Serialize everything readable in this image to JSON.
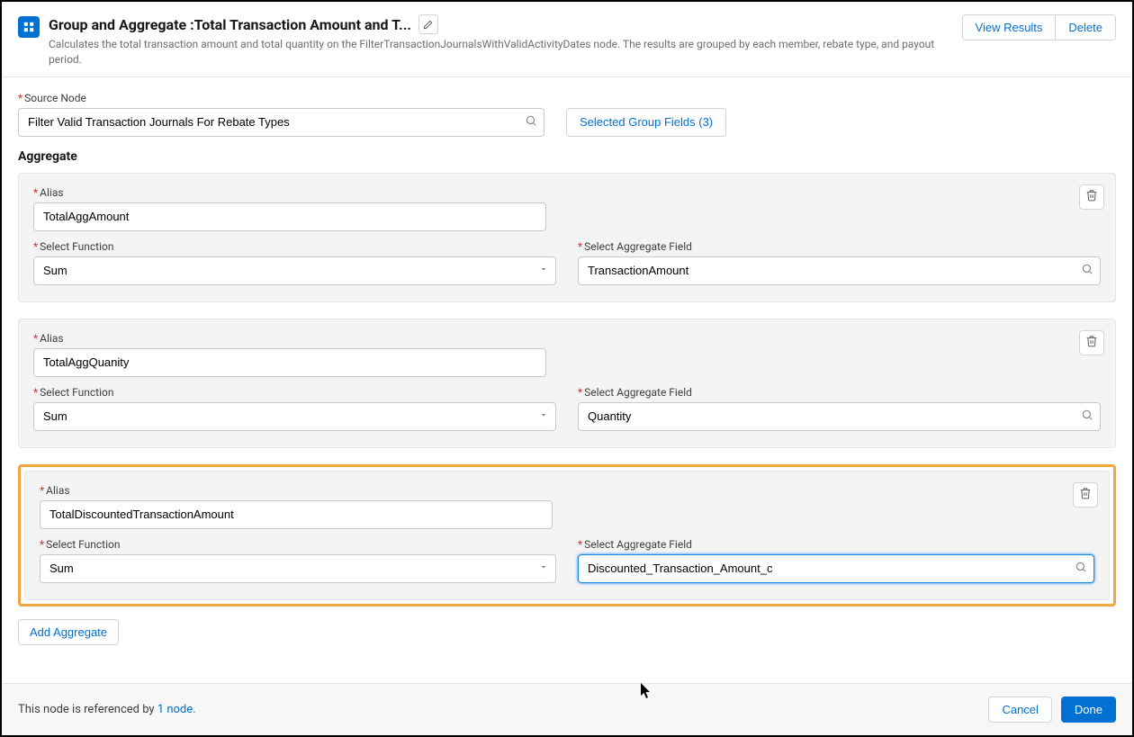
{
  "header": {
    "title_prefix": "Group and Aggregate :  ",
    "title_name": "Total Transaction Amount and T...",
    "description": "Calculates the total transaction amount and total quantity on the FilterTransactionJournalsWithValidActivityDates node. The results are grouped by each member, rebate type, and payout period.",
    "view_results": "View Results",
    "delete": "Delete"
  },
  "source": {
    "label": "Source Node",
    "value": "Filter Valid Transaction Journals For Rebate Types",
    "group_fields_btn": "Selected Group Fields (3)"
  },
  "aggregate_section_title": "Aggregate",
  "labels": {
    "alias": "Alias",
    "select_function": "Select Function",
    "select_agg_field": "Select Aggregate Field"
  },
  "aggregates": [
    {
      "alias": "TotalAggAmount",
      "function": "Sum",
      "field": "TransactionAmount",
      "highlighted": false,
      "field_focused": false
    },
    {
      "alias": "TotalAggQuanity",
      "function": "Sum",
      "field": "Quantity",
      "highlighted": false,
      "field_focused": false
    },
    {
      "alias": "TotalDiscountedTransactionAmount",
      "function": "Sum",
      "field": "Discounted_Transaction_Amount_c",
      "highlighted": true,
      "field_focused": true
    }
  ],
  "add_aggregate": "Add Aggregate",
  "footer": {
    "text_prefix": "This node is referenced by ",
    "link": "1 node.",
    "cancel": "Cancel",
    "done": "Done"
  }
}
